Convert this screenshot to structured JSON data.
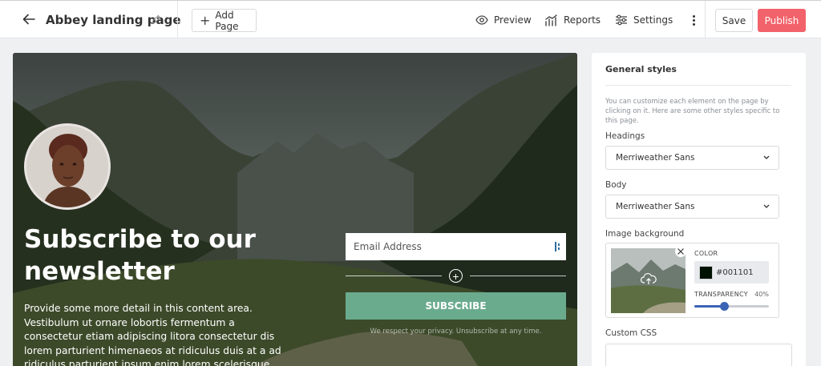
{
  "topbar": {
    "page_title": "Abbey landing page",
    "add_page_label": "Add Page",
    "nav": {
      "preview": "Preview",
      "reports": "Reports",
      "settings": "Settings"
    },
    "save_label": "Save",
    "publish_label": "Publish"
  },
  "canvas": {
    "headline": "Subscribe to our newsletter",
    "body": "Provide some more detail in this content area. Vestibulum ut ornare lobortis fermentum a consectetur etiam adipiscing litora consectetur dis lorem parturient himenaeos at ridiculus duis at a ad ridiculus parturient ipsum enim lorem scelerisque",
    "email_placeholder": "Email Address",
    "subscribe_label": "SUBSCRIBE",
    "privacy_note": "We respect your privacy. Unsubscribe at any time."
  },
  "panel": {
    "title": "General styles",
    "description": "You can customize each element on the page by clicking on it. Here are some other styles specific to this page.",
    "headings_label": "Headings",
    "headings_value": "Merriweather Sans",
    "body_label": "Body",
    "body_value": "Merriweather Sans",
    "image_bg_label": "Image background",
    "color_label": "COLOR",
    "color_value": "#001101",
    "transparency_label": "TRANSPARENCY",
    "transparency_value": "40%",
    "transparency_fraction": 0.4,
    "custom_css_label": "Custom CSS"
  },
  "colors": {
    "publish": "#f2626a",
    "subscribe": "#6aab8e",
    "slider": "#3b63b5",
    "swatch": "#001101"
  },
  "icons": [
    "arrow-left-icon",
    "pencil-icon",
    "plus-icon",
    "eye-icon",
    "chart-icon",
    "sliders-icon",
    "dots-vertical-icon",
    "chevron-down-icon",
    "close-icon",
    "cloud-upload-icon",
    "plus-circle-icon"
  ]
}
